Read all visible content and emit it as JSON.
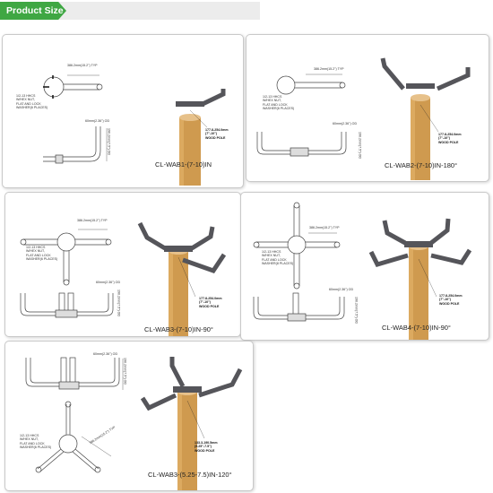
{
  "header": {
    "title": "Product Size"
  },
  "colors": {
    "accent": "#3fa743",
    "pole": "#cf9a4f",
    "arm": "#55555a"
  },
  "cards": [
    {
      "model": "CL-WAB1-(7-10)IN",
      "arm_length": "386.2mm(15.2\") TYP",
      "od": "60mm(2.36\") OD",
      "height": "190.2mm(7.5\") OD",
      "bolt": "1/2-13 HHCS\nW/HEX NUT,\nFLAT AND LOCK\nWASHER(6 PLACES)",
      "pole": "177.8-254.0mm\n(7\"-10\")\nWOOD POLE"
    },
    {
      "model": "CL-WAB2-(7-10)IN-180°",
      "arm_length": "386.2mm(15.2\") TYP",
      "od": "60mm(2.36\") OD",
      "height": "190.2mm(7.5\") OD",
      "bolt": "1/2-13 HHCS\nW/HEX NUT,\nFLAT AND LOCK\nWASHER(6 PLACES)",
      "pole": "177.8-254.0mm\n(7\"-10\")\nWOOD POLE"
    },
    {
      "model": "CL-WAB3-(7-10)IN-90°",
      "arm_length": "386.2mm(15.2\") TYP",
      "od": "60mm(2.36\") OD",
      "height": "190.2mm(7.5\") OD",
      "bolt": "1/2-13 HHCS\nW/HEX NUT,\nFLAT AND LOCK\nWASHER(6 PLACES)",
      "pole": "177.8-254.0mm\n(7\"-10\")\nWOOD POLE"
    },
    {
      "model": "CL-WAB4-(7-10)IN-90°",
      "arm_length": "386.2mm(15.2\") TYP",
      "od": "60mm(2.36\") OD",
      "height": "190.2mm(7.5\") OD",
      "bolt": "1/2-13 HHCS\nW/HEX NUT,\nFLAT AND LOCK\nWASHER(8 PLACES)",
      "pole": "177.8-254.0mm\n(7\"-10\")\nWOOD POLE"
    },
    {
      "model": "CL-WAB3-(5.25-7.5)IN-120°",
      "arm_length": "386.2mm(15.2\") TYP",
      "od": "60mm(2.36\") OD",
      "height": "190.2mm(7.5\") OD",
      "bolt": "1/2-13 HHCS\nW/HEX NUT,\nFLAT AND LOCK\nWASHER(6 PLACES)",
      "pole": "133.3-190.5mm\n(5.25\"-7.5\")\nWOOD POLE"
    }
  ]
}
